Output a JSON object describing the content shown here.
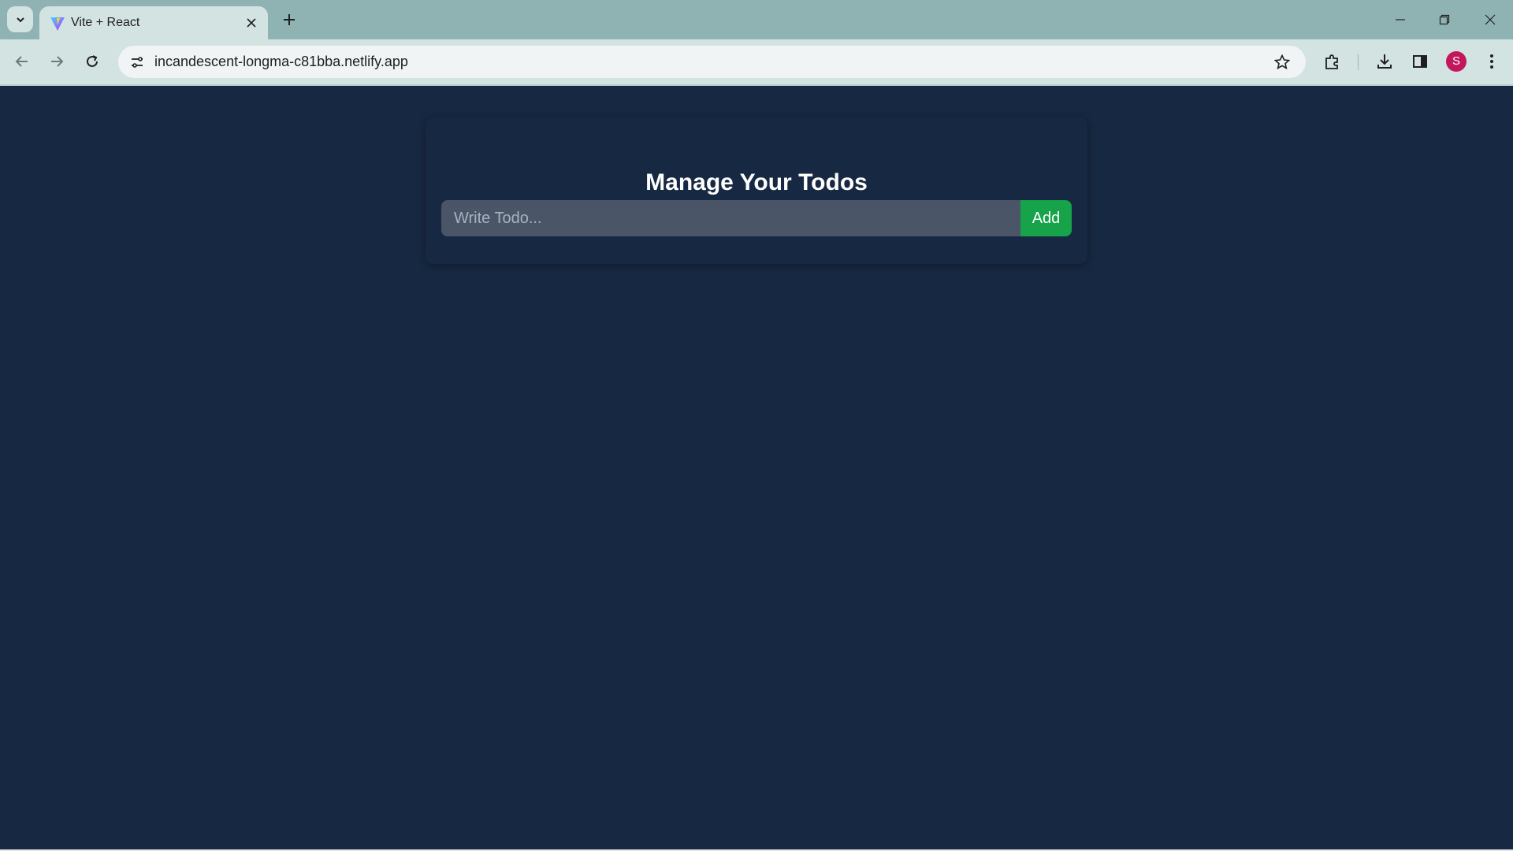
{
  "browser": {
    "tab": {
      "title": "Vite + React",
      "favicon": "vite-logo-icon"
    },
    "address_bar": {
      "url": "incandescent-longma-c81bba.netlify.app"
    },
    "profile": {
      "initial": "S",
      "color": "#c2185b"
    }
  },
  "page": {
    "title": "Manage Your Todos",
    "input": {
      "placeholder": "Write Todo...",
      "value": ""
    },
    "add_button_label": "Add",
    "colors": {
      "background": "#172842",
      "input_background": "#4a5568",
      "add_button": "#16a34a"
    }
  }
}
